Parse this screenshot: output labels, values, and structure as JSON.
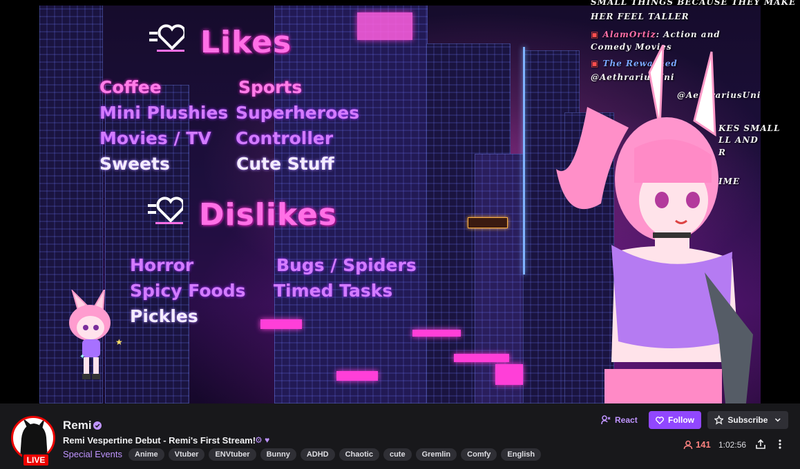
{
  "stream": {
    "likes_heading": "Likes",
    "likes": [
      [
        "Coffee",
        "Sports"
      ],
      [
        "Mini Plushies",
        "Superheroes"
      ],
      [
        "Movies / TV",
        "Controller"
      ],
      [
        "Sweets",
        "Cute Stuff"
      ]
    ],
    "dislikes_heading": "Dislikes",
    "dislikes": [
      [
        "Horror",
        "Bugs / Spiders"
      ],
      [
        "Spicy Foods",
        "Timed Tasks"
      ],
      [
        "Pickles",
        ""
      ]
    ],
    "chat_overlay": [
      {
        "user": "",
        "text": "SMALL THINGS BECAUSE THEY MAKE"
      },
      {
        "user": "",
        "text": "HER FEEL TALLER"
      },
      {
        "user": "AlamOrtiz",
        "text": ": Action and"
      },
      {
        "user": "",
        "text": "Comedy Movies"
      },
      {
        "user": "The Rewarned",
        "text": ""
      },
      {
        "user": "",
        "text": "@AethrariusUni"
      },
      {
        "user": "",
        "text": "@AethrariusUni"
      },
      {
        "user": "",
        "text": "KES SMALL"
      },
      {
        "user": "",
        "text": "LL AND"
      },
      {
        "user": "",
        "text": "R"
      },
      {
        "user": "",
        "text": "IME"
      }
    ]
  },
  "channel": {
    "name": "Remi",
    "live_label": "LIVE",
    "title": "Remi Vespertine Debut - Remi's First Stream!",
    "category": "Special Events",
    "tags": [
      "Anime",
      "Vtuber",
      "ENVtuber",
      "Bunny",
      "ADHD",
      "Chaotic",
      "cute",
      "Gremlin",
      "Comfy",
      "English"
    ],
    "viewers": "141",
    "uptime": "1:02:56"
  },
  "actions": {
    "react": "React",
    "follow": "Follow",
    "subscribe": "Subscribe"
  },
  "colors": {
    "accent": "#9147ff",
    "accent_text": "#bf94ff",
    "live": "#eb0400",
    "viewer": "#ff8280",
    "panel_bg": "#18181b"
  },
  "icons": {
    "react": "react-person-icon",
    "follow": "heart-icon",
    "subscribe": "star-icon",
    "viewers": "person-icon",
    "share": "share-icon",
    "more": "more-vertical-icon",
    "verified": "verified-badge-icon"
  }
}
